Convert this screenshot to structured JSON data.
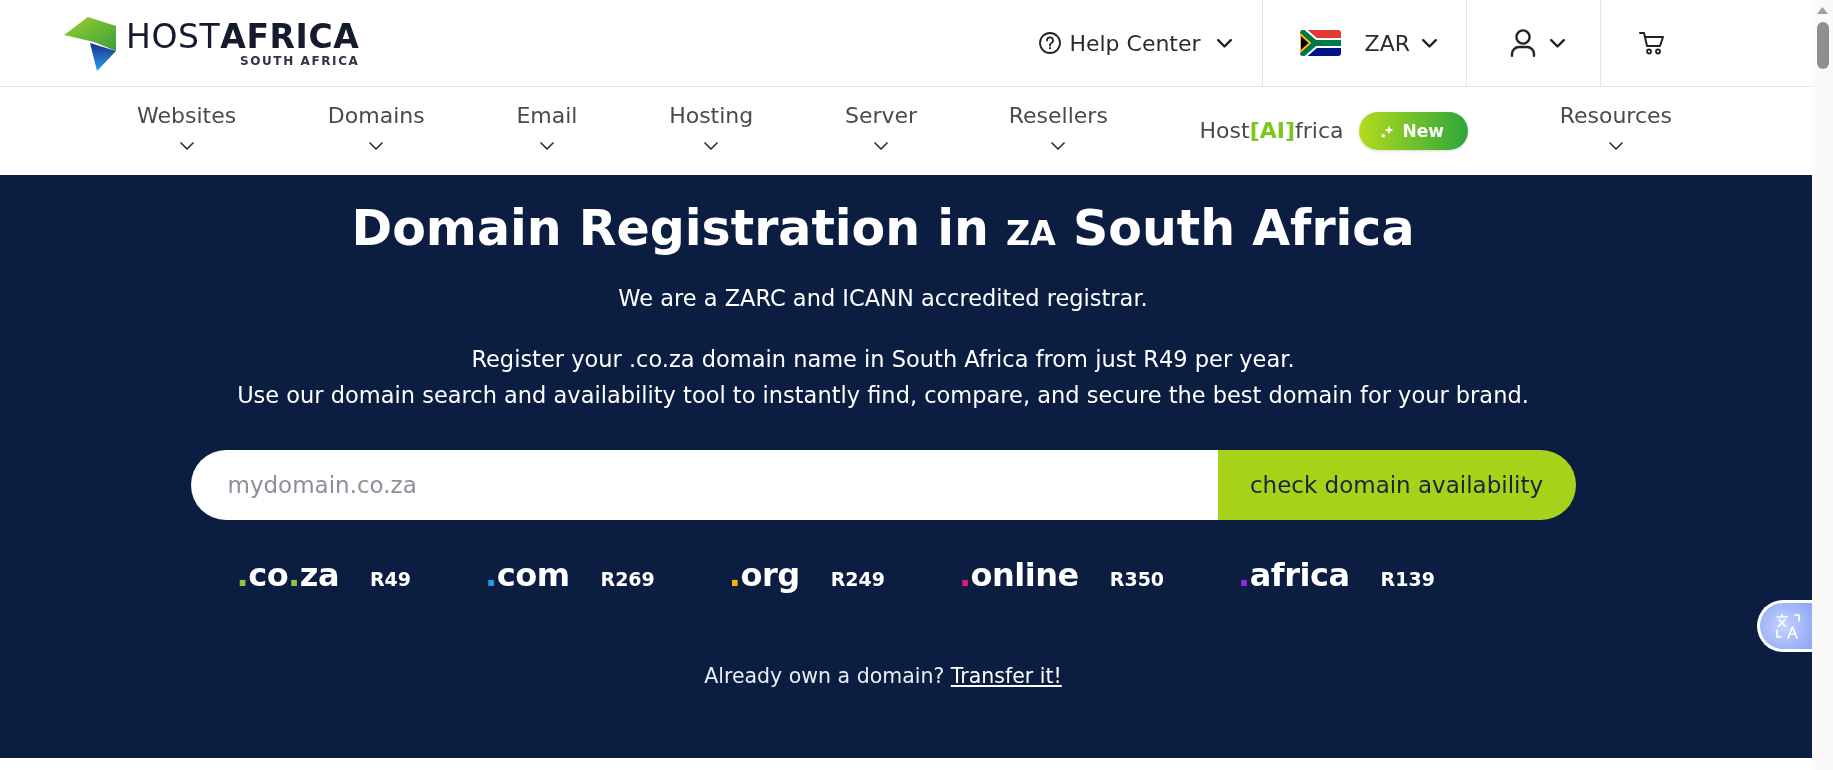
{
  "top_bar": {
    "logo": {
      "name": "HOST**AFRICA**",
      "tagline": "SOUTH AFRICA"
    },
    "help": {
      "label": "Help Center"
    },
    "currency": {
      "label": "ZAR"
    }
  },
  "nav": [
    {
      "label": "Websites",
      "kind": "menu"
    },
    {
      "label": "Domains",
      "kind": "menu"
    },
    {
      "label": "Email",
      "kind": "menu"
    },
    {
      "label": "Hosting",
      "kind": "menu"
    },
    {
      "label": "Server",
      "kind": "menu"
    },
    {
      "label": "Resellers",
      "kind": "menu"
    },
    {
      "label": "Host**[AI]**frica",
      "kind": "feature",
      "badge": "New"
    },
    {
      "label": "Resources",
      "kind": "menu"
    }
  ],
  "hero": {
    "heading": {
      "before": "Domain Registration in",
      "flag_letters": "ZA",
      "after": "South Africa"
    },
    "accreditation": "We are a ZARC and ICANN accredited registrar.",
    "description": [
      "Register your .co.za domain name in South Africa from just R49 per year.",
      "Use our domain search and availability tool to instantly find, compare, and secure the best domain for your brand."
    ],
    "search": {
      "placeholder": "mydomain.co.za",
      "button": "check domain availability"
    },
    "extensions": [
      {
        "name": ".co.za",
        "color": "#8dc63f",
        "price": "R49"
      },
      {
        "name": ".com",
        "color": "#1e9be9",
        "price": "R269"
      },
      {
        "name": ".org",
        "color": "#f5b400",
        "price": "R249"
      },
      {
        "name": ".online",
        "color": "#e6176f",
        "price": "R350"
      },
      {
        "name": ".africa",
        "color": "#8b2be2",
        "price": "R139"
      }
    ],
    "transfer": {
      "text": "Already own a domain?",
      "link": "Transfer it!"
    }
  }
}
